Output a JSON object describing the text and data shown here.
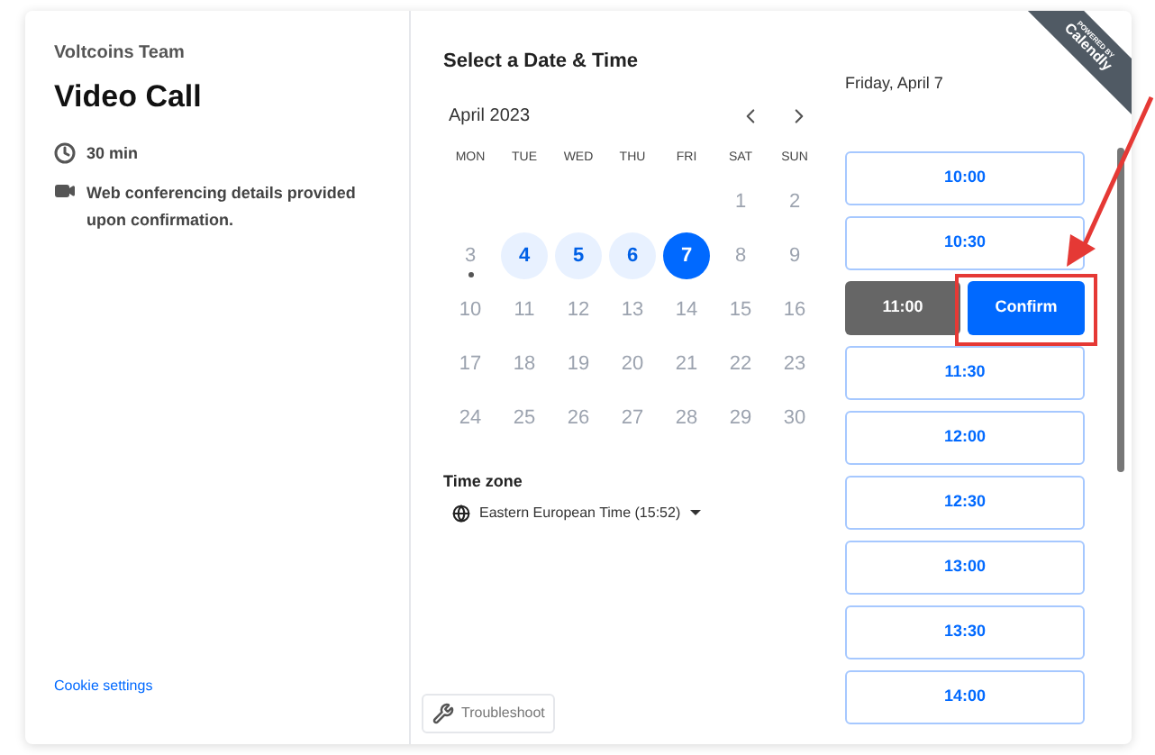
{
  "event": {
    "team": "Voltcoins Team",
    "title": "Video Call",
    "duration": "30 min",
    "location": "Web conferencing details provided upon confirmation."
  },
  "cookie_link": "Cookie settings",
  "calendar": {
    "heading": "Select a Date & Time",
    "month": "April 2023",
    "weekdays": [
      "MON",
      "TUE",
      "WED",
      "THU",
      "FRI",
      "SAT",
      "SUN"
    ],
    "weeks": [
      {
        "starts_midweek": true,
        "days": [
          {
            "label": "1",
            "available": false,
            "selected": false,
            "today": false
          },
          {
            "label": "2",
            "available": false,
            "selected": false,
            "today": false
          }
        ]
      },
      {
        "starts_midweek": false,
        "days": [
          {
            "label": "3",
            "available": false,
            "selected": false,
            "today": true
          },
          {
            "label": "4",
            "available": true,
            "selected": false,
            "today": false
          },
          {
            "label": "5",
            "available": true,
            "selected": false,
            "today": false
          },
          {
            "label": "6",
            "available": true,
            "selected": false,
            "today": false
          },
          {
            "label": "7",
            "available": true,
            "selected": true,
            "today": false
          },
          {
            "label": "8",
            "available": false,
            "selected": false,
            "today": false
          },
          {
            "label": "9",
            "available": false,
            "selected": false,
            "today": false
          }
        ]
      },
      {
        "starts_midweek": false,
        "days": [
          {
            "label": "10",
            "available": false,
            "selected": false,
            "today": false
          },
          {
            "label": "11",
            "available": false,
            "selected": false,
            "today": false
          },
          {
            "label": "12",
            "available": false,
            "selected": false,
            "today": false
          },
          {
            "label": "13",
            "available": false,
            "selected": false,
            "today": false
          },
          {
            "label": "14",
            "available": false,
            "selected": false,
            "today": false
          },
          {
            "label": "15",
            "available": false,
            "selected": false,
            "today": false
          },
          {
            "label": "16",
            "available": false,
            "selected": false,
            "today": false
          }
        ]
      },
      {
        "starts_midweek": false,
        "days": [
          {
            "label": "17",
            "available": false,
            "selected": false,
            "today": false
          },
          {
            "label": "18",
            "available": false,
            "selected": false,
            "today": false
          },
          {
            "label": "19",
            "available": false,
            "selected": false,
            "today": false
          },
          {
            "label": "20",
            "available": false,
            "selected": false,
            "today": false
          },
          {
            "label": "21",
            "available": false,
            "selected": false,
            "today": false
          },
          {
            "label": "22",
            "available": false,
            "selected": false,
            "today": false
          },
          {
            "label": "23",
            "available": false,
            "selected": false,
            "today": false
          }
        ]
      },
      {
        "starts_midweek": false,
        "days": [
          {
            "label": "24",
            "available": false,
            "selected": false,
            "today": false
          },
          {
            "label": "25",
            "available": false,
            "selected": false,
            "today": false
          },
          {
            "label": "26",
            "available": false,
            "selected": false,
            "today": false
          },
          {
            "label": "27",
            "available": false,
            "selected": false,
            "today": false
          },
          {
            "label": "28",
            "available": false,
            "selected": false,
            "today": false
          },
          {
            "label": "29",
            "available": false,
            "selected": false,
            "today": false
          },
          {
            "label": "30",
            "available": false,
            "selected": false,
            "today": false
          }
        ]
      }
    ],
    "timezone_label": "Time zone",
    "timezone": "Eastern European Time (15:52)"
  },
  "troubleshoot": "Troubleshoot",
  "badge": {
    "line1": "POWERED BY",
    "line2": "Calendly"
  },
  "times": {
    "date": "Friday, April 7",
    "confirm": "Confirm",
    "slots": [
      {
        "time": "10:00",
        "selected": false
      },
      {
        "time": "10:30",
        "selected": false
      },
      {
        "time": "11:00",
        "selected": true
      },
      {
        "time": "11:30",
        "selected": false
      },
      {
        "time": "12:00",
        "selected": false
      },
      {
        "time": "12:30",
        "selected": false
      },
      {
        "time": "13:00",
        "selected": false
      },
      {
        "time": "13:30",
        "selected": false
      },
      {
        "time": "14:00",
        "selected": false
      }
    ]
  }
}
